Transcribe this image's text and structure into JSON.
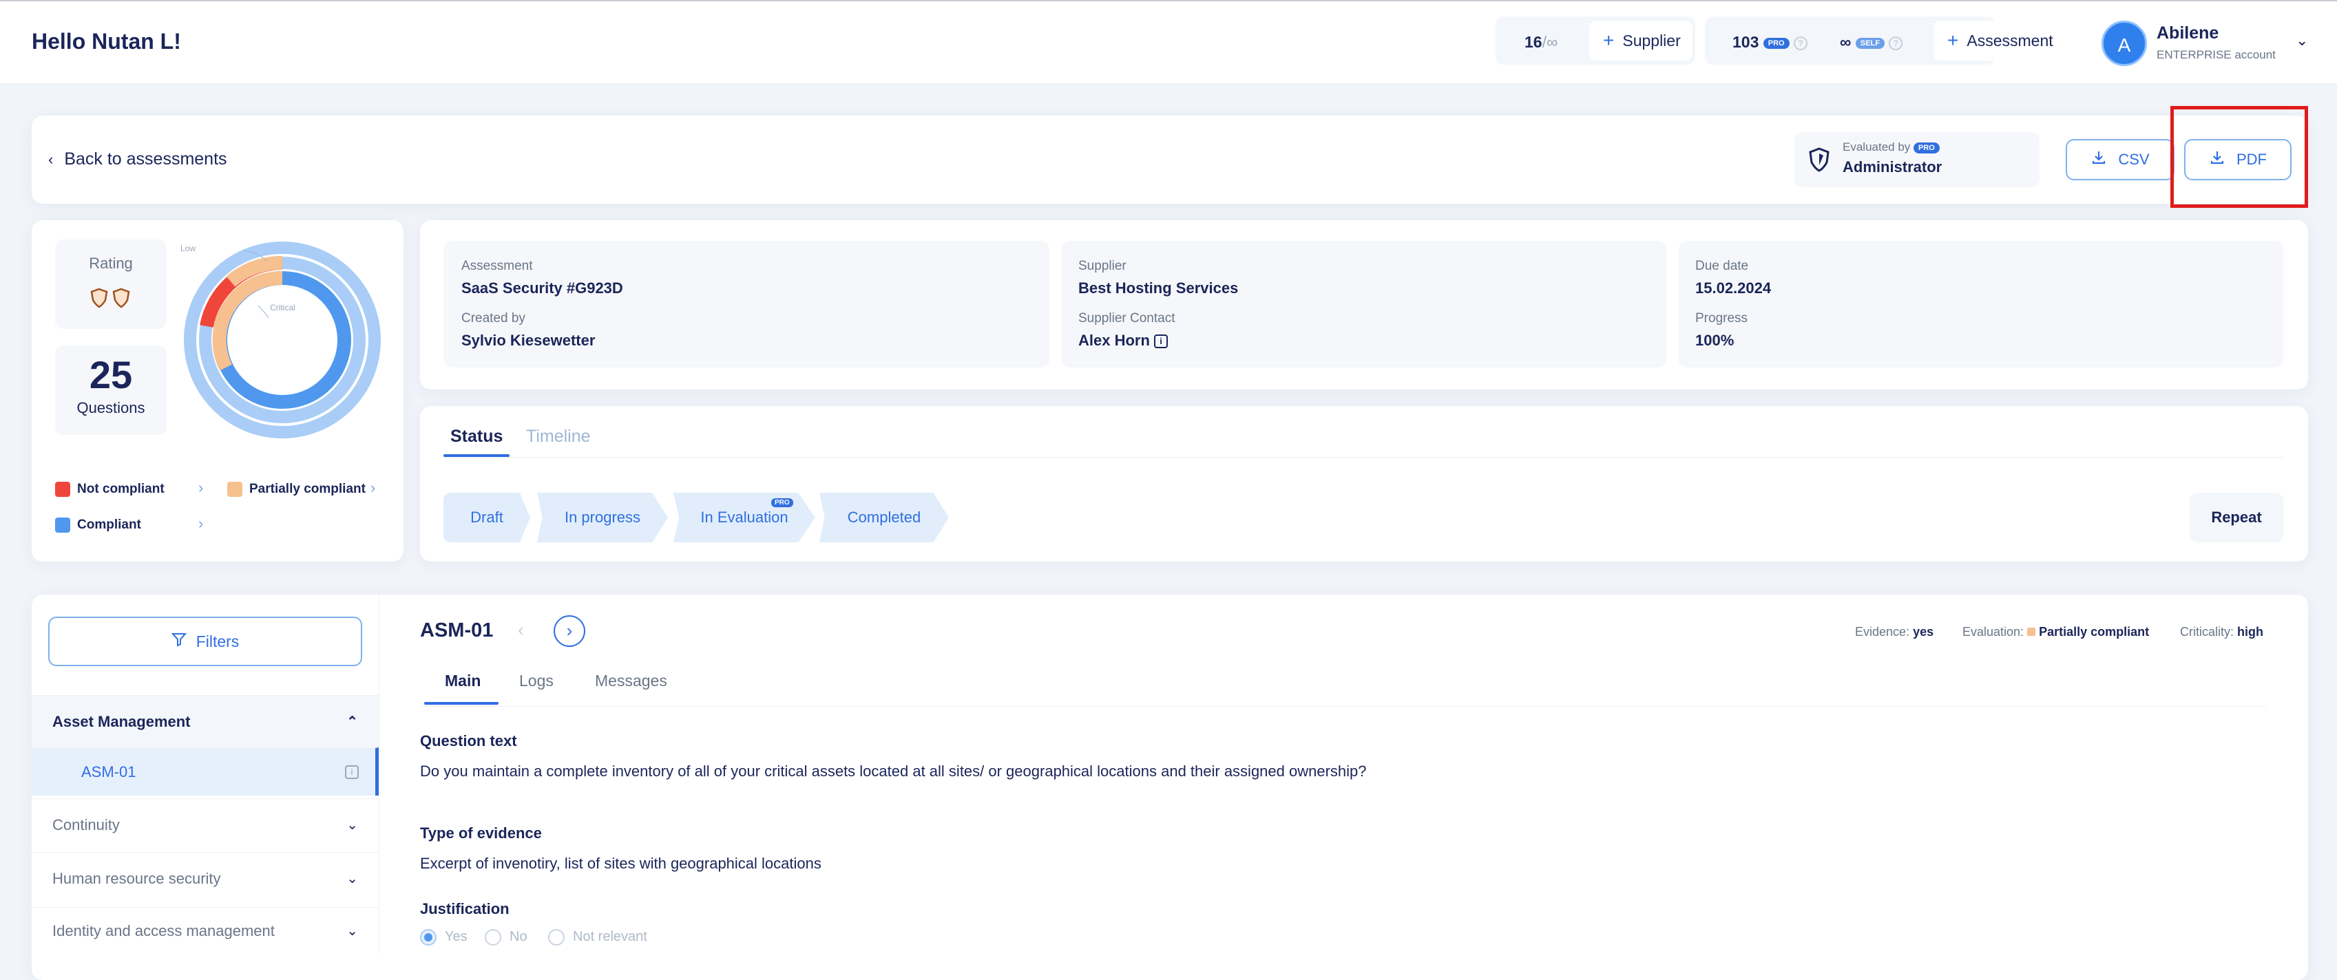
{
  "header": {
    "greeting": "Hello Nutan L!",
    "supplier_count": "16",
    "supplier_limit": "/∞",
    "supplier_button": "Supplier",
    "pro_count": "103",
    "pro_badge": "PRO",
    "self_count": "∞",
    "self_badge": "SELF",
    "assessment_button": "Assessment",
    "user_initial": "A",
    "user_name": "Abilene",
    "user_plan": "ENTERPRISE account"
  },
  "toolbar": {
    "back_label": "Back to assessments",
    "evaluated_by_label": "Evaluated by",
    "evaluated_badge": "PRO",
    "evaluator": "Administrator",
    "csv_label": "CSV",
    "pdf_label": "PDF"
  },
  "summary": {
    "rating_label": "Rating",
    "questions_count": "25",
    "questions_label": "Questions",
    "chart_label_low": "Low",
    "chart_label_critical": "Critical",
    "legend": [
      {
        "label": "Not compliant",
        "color": "#f0453a"
      },
      {
        "label": "Partially compliant",
        "color": "#f7c08f"
      },
      {
        "label": "Compliant",
        "color": "#4f98ee"
      }
    ]
  },
  "info": {
    "assessment_label": "Assessment",
    "assessment_value": "SaaS Security #G923D",
    "created_by_label": "Created by",
    "created_by_value": "Sylvio Kiesewetter",
    "supplier_label": "Supplier",
    "supplier_value": "Best Hosting Services",
    "supplier_contact_label": "Supplier Contact",
    "supplier_contact_value": "Alex Horn",
    "due_date_label": "Due date",
    "due_date_value": "15.02.2024",
    "progress_label": "Progress",
    "progress_value": "100%"
  },
  "status": {
    "tabs": [
      "Status",
      "Timeline"
    ],
    "steps": [
      "Draft",
      "In progress",
      "In Evaluation",
      "Completed"
    ],
    "step_badge": "PRO",
    "repeat_label": "Repeat"
  },
  "sidebar": {
    "filters_label": "Filters",
    "sections": [
      {
        "label": "Asset Management",
        "expanded": true
      },
      {
        "label": "Continuity",
        "expanded": false
      },
      {
        "label": "Human resource security",
        "expanded": false
      },
      {
        "label": "Identity and access management",
        "expanded": false
      }
    ],
    "active_item": "ASM-01"
  },
  "question": {
    "id": "ASM-01",
    "evidence_label": "Evidence:",
    "evidence_value": "yes",
    "evaluation_label": "Evaluation:",
    "evaluation_value": "Partially compliant",
    "criticality_label": "Criticality:",
    "criticality_value": "high",
    "tabs": [
      "Main",
      "Logs",
      "Messages"
    ],
    "question_text_label": "Question text",
    "question_text": "Do you maintain a complete inventory of all of your critical assets located at all sites/ or geographical locations and their assigned ownership?",
    "evidence_type_label": "Type of evidence",
    "evidence_type": "Excerpt of invenotiry, list of sites with geographical locations",
    "justification_label": "Justification",
    "options": [
      "Yes",
      "No",
      "Not relevant"
    ]
  },
  "colors": {
    "accent": "#2f6fe0",
    "highlight": "#e11b1b"
  }
}
